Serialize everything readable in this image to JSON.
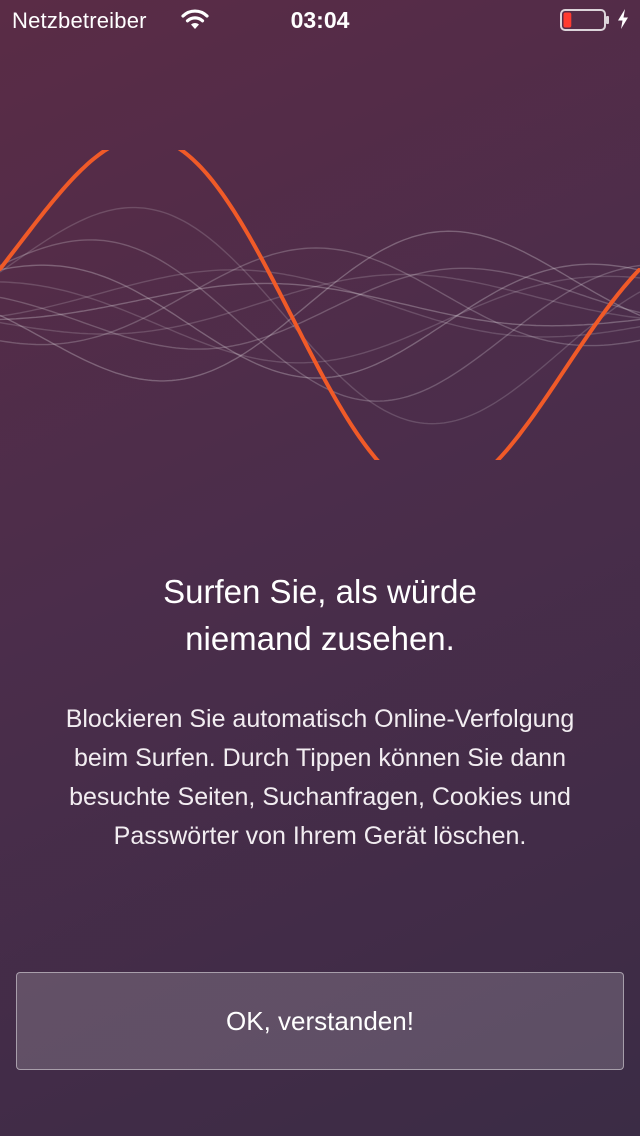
{
  "status_bar": {
    "carrier": "Netzbetreiber",
    "time": "03:04",
    "battery_level": 0.2,
    "battery_color": "#ff3b30",
    "charging": true,
    "wifi_icon": "wifi-icon",
    "battery_icon": "battery-icon",
    "charging_icon": "bolt-icon"
  },
  "illustration": {
    "icon": "sound-wave-illustration",
    "accent_color": "#f05a28"
  },
  "onboarding": {
    "title_line1": "Surfen Sie, als würde",
    "title_line2": "niemand zusehen.",
    "body_line1": "Blockieren Sie automatisch Online-Verfolgung",
    "body_line2": "beim Surfen. Durch Tippen können Sie dann",
    "body_line3": "besuchte Seiten, Suchanfragen, Cookies und",
    "body_line4": "Passwörter von Ihrem Gerät löschen.",
    "ok_button_label": "OK, verstanden!"
  },
  "colors": {
    "background_top": "#5a2c46",
    "background_bottom": "#3b2c45",
    "text": "#ffffff"
  }
}
